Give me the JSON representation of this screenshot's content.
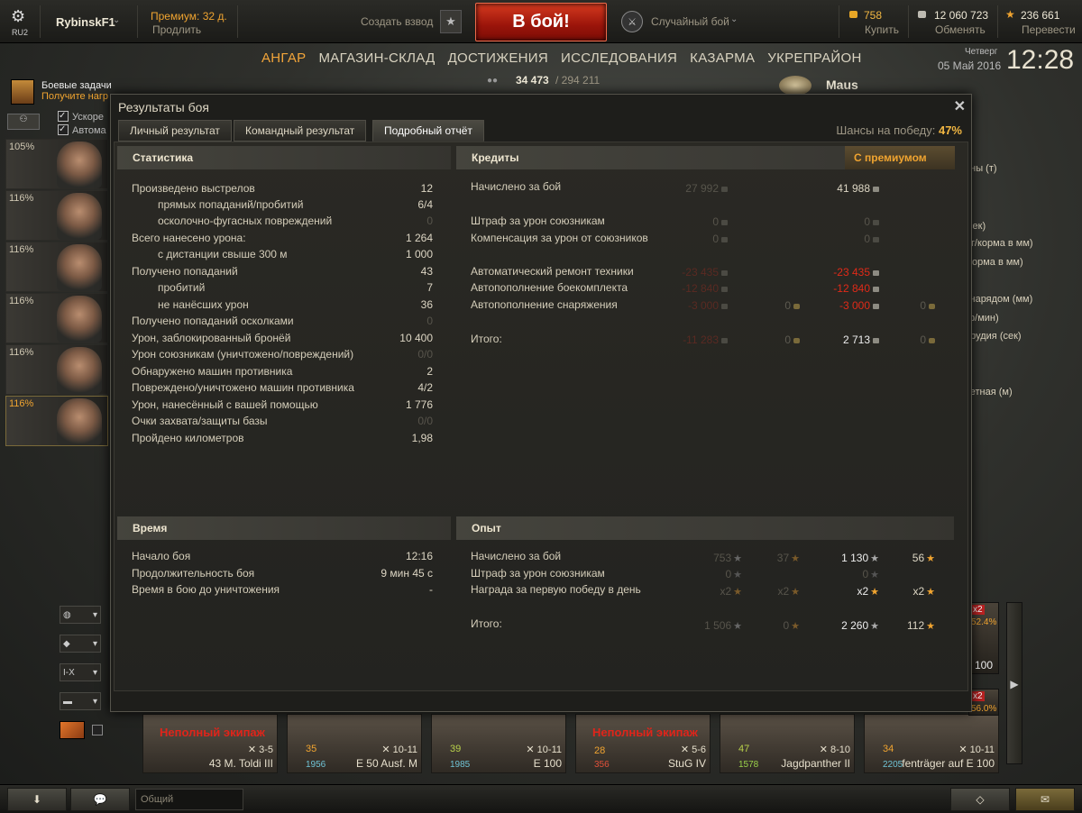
{
  "topbar": {
    "server": "RU2",
    "username": "RybinskF1",
    "premium_label": "Премиум: 32 д.",
    "premium_action": "Продлить",
    "platoon": "Создать взвод",
    "battle_button": "В бой!",
    "battle_mode": "Случайный бой",
    "gold": "758",
    "gold_action": "Купить",
    "credits": "12 060 723",
    "credits_action": "Обменять",
    "free_xp": "236 661",
    "free_xp_action": "Перевести"
  },
  "nav": [
    "АНГАР",
    "МАГАЗИН-СКЛАД",
    "ДОСТИЖЕНИЯ",
    "ИССЛЕДОВАНИЯ",
    "КАЗАРМА",
    "УКРЕПРАЙОН"
  ],
  "clock": {
    "day": "Четверг",
    "date": "05 Май 2016",
    "time": "12:28"
  },
  "online": {
    "value": "34 473",
    "total": "/ 294 211"
  },
  "missions": {
    "title": "Боевые задачи",
    "subtitle": "Получите нагр"
  },
  "checkboxes": [
    "Ускоре",
    "Автома"
  ],
  "vehicle_name": "Maus",
  "crew": [
    "105%",
    "116%",
    "116%",
    "116%",
    "116%",
    "116%"
  ],
  "modal": {
    "title": "Результаты боя",
    "tabs": [
      "Личный результат",
      "Командный результат",
      "Подробный отчёт"
    ],
    "win_chance_label": "Шансы на победу:",
    "win_chance_value": "47%",
    "stats": {
      "header": "Статистика",
      "rows": [
        {
          "label": "Произведено выстрелов",
          "value": "12"
        },
        {
          "label": "прямых попаданий/пробитий",
          "value": "6/4"
        },
        {
          "label": "осколочно-фугасных повреждений",
          "value": "0"
        },
        {
          "label": "Всего нанесено урона:",
          "value": "1 264"
        },
        {
          "label": "с дистанции свыше 300 м",
          "value": "1 000"
        },
        {
          "label": "Получено попаданий",
          "value": "43"
        },
        {
          "label": "пробитий",
          "value": "7"
        },
        {
          "label": "не нанёсших урон",
          "value": "36"
        },
        {
          "label": "Получено попаданий осколками",
          "value": "0"
        },
        {
          "label": "Урон, заблокированный бронёй",
          "value": "10 400"
        },
        {
          "label": "Урон союзникам (уничтожено/повреждений)",
          "value": "0/0"
        },
        {
          "label": "Обнаружено машин противника",
          "value": "2"
        },
        {
          "label": "Повреждено/уничтожено машин противника",
          "value": "4/2"
        },
        {
          "label": "Урон, нанесённый с вашей помощью",
          "value": "1 776"
        },
        {
          "label": "Очки захвата/защиты базы",
          "value": "0/0"
        },
        {
          "label": "Пройдено километров",
          "value": "1,98"
        }
      ]
    },
    "credits": {
      "header": "Кредиты",
      "premium_header": "С премиумом",
      "rows": [
        {
          "label": "Начислено за бой",
          "base": "27 992",
          "prem": "41 988"
        },
        {
          "label": "Штраф за урон союзникам",
          "base": "0",
          "prem": "0"
        },
        {
          "label": "Компенсация за урон от союзников",
          "base": "0",
          "prem": "0"
        },
        {
          "label": "Автоматический ремонт техники",
          "base": "-23 435",
          "prem": "-23 435"
        },
        {
          "label": "Автопополнение боекомплекта",
          "base": "-12 840",
          "prem": "-12 840"
        },
        {
          "label": "Автопополнение снаряжения",
          "base": "-3 000",
          "base_gold": "0",
          "prem": "-3 000",
          "prem_gold": "0"
        },
        {
          "label": "Итого:",
          "base": "-11 283",
          "base_gold": "0",
          "prem": "2 713",
          "prem_gold": "0"
        }
      ]
    },
    "time": {
      "header": "Время",
      "rows": [
        {
          "label": "Начало боя",
          "value": "12:16"
        },
        {
          "label": "Продолжительность боя",
          "value": "9 мин 45 с"
        },
        {
          "label": "Время в бою до уничтожения",
          "value": "-"
        }
      ]
    },
    "xp": {
      "header": "Опыт",
      "rows": [
        {
          "label": "Начислено за бой",
          "base": "753",
          "base_free": "37",
          "prem": "1 130",
          "prem_free": "56"
        },
        {
          "label": "Штраф за урон союзникам",
          "base": "0",
          "prem": "0"
        },
        {
          "label": "Награда за первую победу в день",
          "base": "x2",
          "base_free": "x2",
          "prem": "x2",
          "prem_free": "x2"
        },
        {
          "label": "Итого:",
          "base": "1 506",
          "base_free": "0",
          "prem": "2 260",
          "prem_free": "112"
        }
      ]
    }
  },
  "right_panel": [
    "ины (т)",
    "/сек)",
    "рт/корма в мм)",
    "/корма в мм)",
    "снарядом (мм)",
    "тр/мин)",
    "орудия (сек)",
    ")",
    "четная (м)"
  ],
  "filters": [
    "I-X"
  ],
  "tanks": [
    {
      "name": "43 M. Toldi III",
      "tier": "3-5",
      "warn": "Неполный экипаж",
      "battles": "",
      "left_num": ""
    },
    {
      "name": "E 50 Ausf. M",
      "tier": "10-11",
      "warn": "",
      "battles": "1956",
      "left_num": "35"
    },
    {
      "name": "E 100",
      "tier": "10-11",
      "warn": "",
      "battles": "1985",
      "left_num": "39"
    },
    {
      "name": "StuG IV",
      "tier": "5-6",
      "warn": "Неполный экипаж",
      "battles": "356",
      "left_num": "28"
    },
    {
      "name": "Jagdpanther II",
      "tier": "8-10",
      "warn": "",
      "battles": "1578",
      "left_num": "47"
    },
    {
      "name": "fenträger auf E 100",
      "tier": "10-11",
      "warn": "",
      "battles": "2205",
      "left_num": "34"
    }
  ],
  "right_tanks": [
    {
      "pct": "52.4%",
      "tier": "10-11",
      "val": "100",
      "badge": "x2"
    },
    {
      "pct": "56.0%",
      "badge": "x2"
    }
  ],
  "chat": {
    "placeholder": "Общий"
  }
}
